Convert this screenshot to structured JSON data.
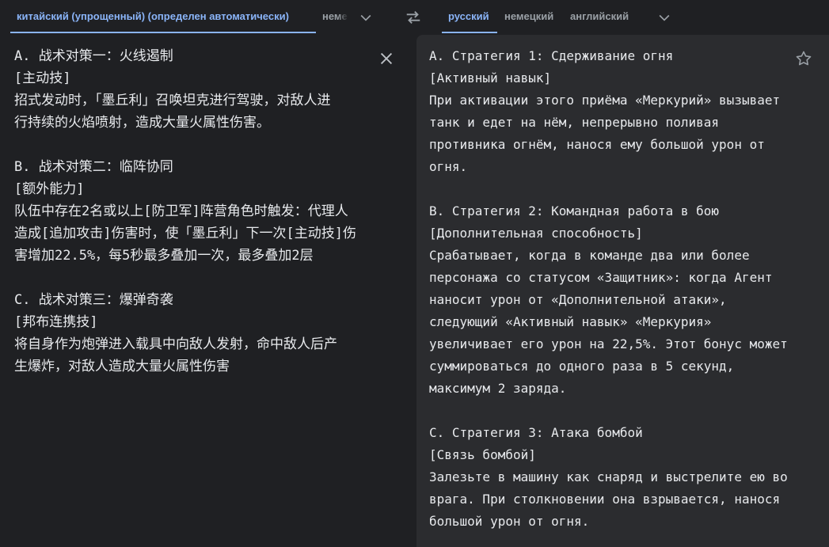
{
  "source_languages": {
    "tabs": [
      {
        "label": "китайский (упрощенный) (определен автоматически)"
      },
      {
        "label": "немецкий"
      }
    ]
  },
  "target_languages": {
    "tabs": [
      {
        "label": "русский"
      },
      {
        "label": "немецкий"
      },
      {
        "label": "английский"
      }
    ]
  },
  "source": {
    "text": "A. 战术对策一：火线遏制\n[主动技]\n招式发动时，「墨丘利」召唤坦克进行驾驶，对敌人进\n行持续的火焰喷射，造成大量火属性伤害。\n\nB. 战术对策二：临阵协同\n[额外能力]\n队伍中存在2名或以上[防卫军]阵营角色时触发：代理人\n造成[追加攻击]伤害时，使「墨丘利」下一次[主动技]伤\n害增加22.5%，每5秒最多叠加一次，最多叠加2层\n\nC. 战术对策三：爆弹奇袭\n[邦布连携技]\n将自身作为炮弹进入载具中向敌人发射，命中敌人后产\n生爆炸，对敌人造成大量火属性伤害"
  },
  "translation": {
    "text": "A. Стратегия 1: Сдерживание огня\n[Активный навык]\nПри активации этого приёма «Меркурий» вызывает\nтанк и едет на нём, непрерывно поливая\nпротивника огнём, нанося ему большой урон от\nогня.\n\nB. Стратегия 2: Командная работа в бою\n[Дополнительная способность]\nСрабатывает, когда в команде два или более\nперсонажа со статусом «Защитник»: когда Агент\nнаносит урон от «Дополнительной атаки»,\nследующий «Активный навык» «Меркурия»\nувеличивает его урон на 22,5%. Этот бонус может\nсуммироваться до одного раза в 5 секунд,\nмаксимум 2 заряда.\n\nC. Стратегия 3: Атака бомбой\n[Связь бомбой]\nЗалезьте в машину как снаряд и выстрелите ею во\nврага. При столкновении она взрывается, нанося\nбольшой урон от огня."
  },
  "colors": {
    "accent": "#8ab4f8",
    "text": "#e8eaed",
    "muted": "#9aa0a6",
    "background": "#1f2023",
    "panel": "#2b2c2f"
  },
  "icons": {
    "swap": "swap-horiz-icon",
    "dropdown": "chevron-down-icon",
    "clear": "close-icon",
    "save": "star-outline-icon"
  }
}
